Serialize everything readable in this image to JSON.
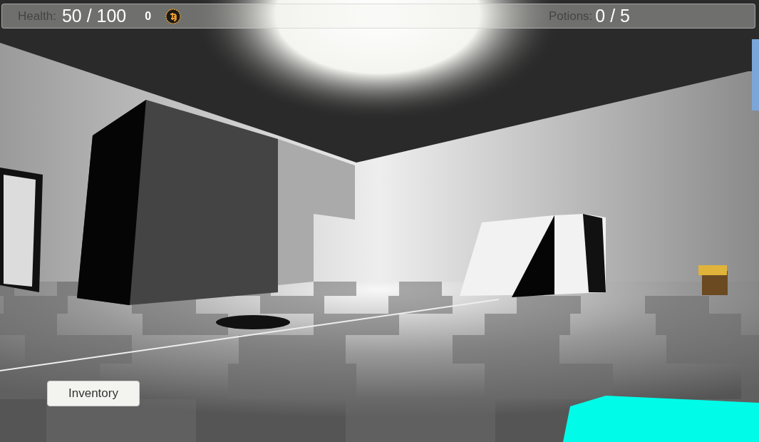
{
  "hud": {
    "health_label": "Health:",
    "health_value": "50 / 100",
    "coins": "0",
    "potions_label": "Potions:",
    "potions_value": "0 / 5"
  },
  "inventory_button": {
    "label": "Inventory"
  }
}
